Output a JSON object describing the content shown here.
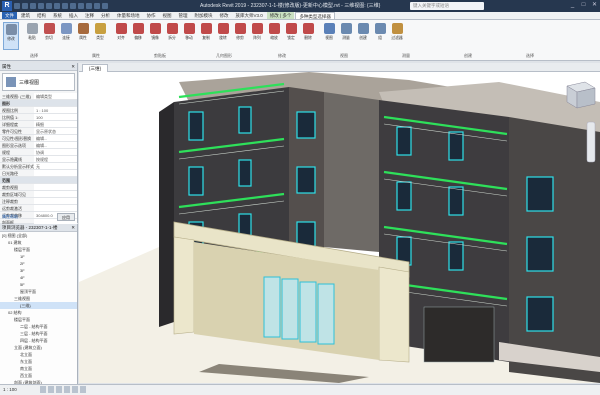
{
  "titlebar": {
    "title": "Autodesk Revit 2019 - 232307-1-1-楼(修改版)-更新中心模型.rvt - 三维视图: {三维}",
    "search_placeholder": "键入关键字或短语"
  },
  "tabs": [
    {
      "label": "文件",
      "kind": "file"
    },
    {
      "label": "建筑"
    },
    {
      "label": "结构"
    },
    {
      "label": "系统"
    },
    {
      "label": "插入"
    },
    {
      "label": "注释"
    },
    {
      "label": "分析"
    },
    {
      "label": "体量和场地"
    },
    {
      "label": "协作"
    },
    {
      "label": "视图"
    },
    {
      "label": "管理"
    },
    {
      "label": "附加模块"
    },
    {
      "label": "修改"
    },
    {
      "label": "族库大师V3.0"
    },
    {
      "label": "修改 | 多个",
      "kind": "ctx"
    },
    {
      "label": "多种类型选择器",
      "kind": "active"
    }
  ],
  "ribbon": {
    "buttons": [
      {
        "label": "修改",
        "color": "#7a8ea8"
      },
      {
        "label": "粘贴",
        "color": "#9aa4b0"
      },
      {
        "label": "剪切",
        "color": "#c05050"
      },
      {
        "label": "连接",
        "color": "#7b96c2"
      },
      {
        "label": "属性",
        "color": "#a66a3d"
      },
      {
        "label": "类型",
        "color": "#c8a040"
      },
      {
        "label": "对齐",
        "color": "#c04a4a"
      },
      {
        "label": "偏移",
        "color": "#c04a4a"
      },
      {
        "label": "镜像",
        "color": "#c04a4a"
      },
      {
        "label": "拆分",
        "color": "#c04a4a"
      },
      {
        "label": "移动",
        "color": "#c04a4a"
      },
      {
        "label": "复制",
        "color": "#c04a4a"
      },
      {
        "label": "旋转",
        "color": "#c04a4a"
      },
      {
        "label": "修剪",
        "color": "#c04a4a"
      },
      {
        "label": "阵列",
        "color": "#c04a4a"
      },
      {
        "label": "缩放",
        "color": "#c04a4a"
      },
      {
        "label": "锁定",
        "color": "#c04a4a"
      },
      {
        "label": "删除",
        "color": "#c04a4a"
      },
      {
        "label": "视图",
        "color": "#5a80b8"
      },
      {
        "label": "测量",
        "color": "#6b8ab0"
      },
      {
        "label": "创建",
        "color": "#6b8ab0"
      },
      {
        "label": "组",
        "color": "#6b8ab0"
      },
      {
        "label": "过滤器",
        "color": "#c09040"
      }
    ],
    "panels": [
      "选择",
      "属性",
      "剪贴板",
      "几何图形",
      "修改",
      "视图",
      "测量",
      "创建",
      "选择"
    ]
  },
  "properties": {
    "header": "属性",
    "type_name": "三维视图",
    "selector_label": "三维视图: {三维}",
    "edit_type": "编辑类型",
    "rows": [
      {
        "k": "图形",
        "v": "",
        "section": true
      },
      {
        "k": "视图比例",
        "v": "1 : 100"
      },
      {
        "k": "比例值 1:",
        "v": "100"
      },
      {
        "k": "详细程度",
        "v": "精细"
      },
      {
        "k": "零件可见性",
        "v": "显示原状态"
      },
      {
        "k": "可见性/图形替换",
        "v": "编辑..."
      },
      {
        "k": "图形显示选项",
        "v": "编辑..."
      },
      {
        "k": "规程",
        "v": "协调"
      },
      {
        "k": "显示隐藏线",
        "v": "按规程"
      },
      {
        "k": "默认分析显示样式",
        "v": "无"
      },
      {
        "k": "日光路径",
        "v": ""
      },
      {
        "k": "范围",
        "v": "",
        "section": true
      },
      {
        "k": "裁剪视图",
        "v": ""
      },
      {
        "k": "裁剪区域可见",
        "v": ""
      },
      {
        "k": "注释裁剪",
        "v": ""
      },
      {
        "k": "远剪裁激活",
        "v": ""
      },
      {
        "k": "远剪裁偏移",
        "v": "304800.0"
      },
      {
        "k": "剖面框",
        "v": ""
      }
    ],
    "help_link": "属性帮助",
    "apply_label": "应用"
  },
  "browser": {
    "header": "项目浏览器 - 232307-1-1-楼",
    "items": [
      {
        "label": "[0] 视图 (全部)",
        "indent": 0
      },
      {
        "label": "01 建筑",
        "indent": 1
      },
      {
        "label": "楼层平面",
        "indent": 2
      },
      {
        "label": "1F",
        "indent": 3
      },
      {
        "label": "2F",
        "indent": 3
      },
      {
        "label": "3F",
        "indent": 3
      },
      {
        "label": "4F",
        "indent": 3
      },
      {
        "label": "5F",
        "indent": 3
      },
      {
        "label": "屋顶平面",
        "indent": 3
      },
      {
        "label": "三维视图",
        "indent": 2
      },
      {
        "label": "{三维}",
        "indent": 3,
        "selected": true
      },
      {
        "label": "02 结构",
        "indent": 1
      },
      {
        "label": "楼层平面",
        "indent": 2
      },
      {
        "label": "二层 - 结构平面",
        "indent": 3
      },
      {
        "label": "三层 - 结构平面",
        "indent": 3
      },
      {
        "label": "四层 - 结构平面",
        "indent": 3
      },
      {
        "label": "立面 (建筑立面)",
        "indent": 2
      },
      {
        "label": "北立面",
        "indent": 3
      },
      {
        "label": "东立面",
        "indent": 3
      },
      {
        "label": "南立面",
        "indent": 3
      },
      {
        "label": "西立面",
        "indent": 3
      },
      {
        "label": "剖面 (建筑剖面)",
        "indent": 2
      }
    ]
  },
  "viewport": {
    "tab_label": "{三维}",
    "viewcube": "前"
  },
  "statusbar": {
    "scale": "1 : 100",
    "text": "单击可进行选择; 按 Tab 键并单击可选择其他项目; 按 Ctrl 键并单击可将新项目添加到选择集; 按 Shift 键并单击可取消选择。",
    "model": "主模型",
    "count": "0"
  }
}
